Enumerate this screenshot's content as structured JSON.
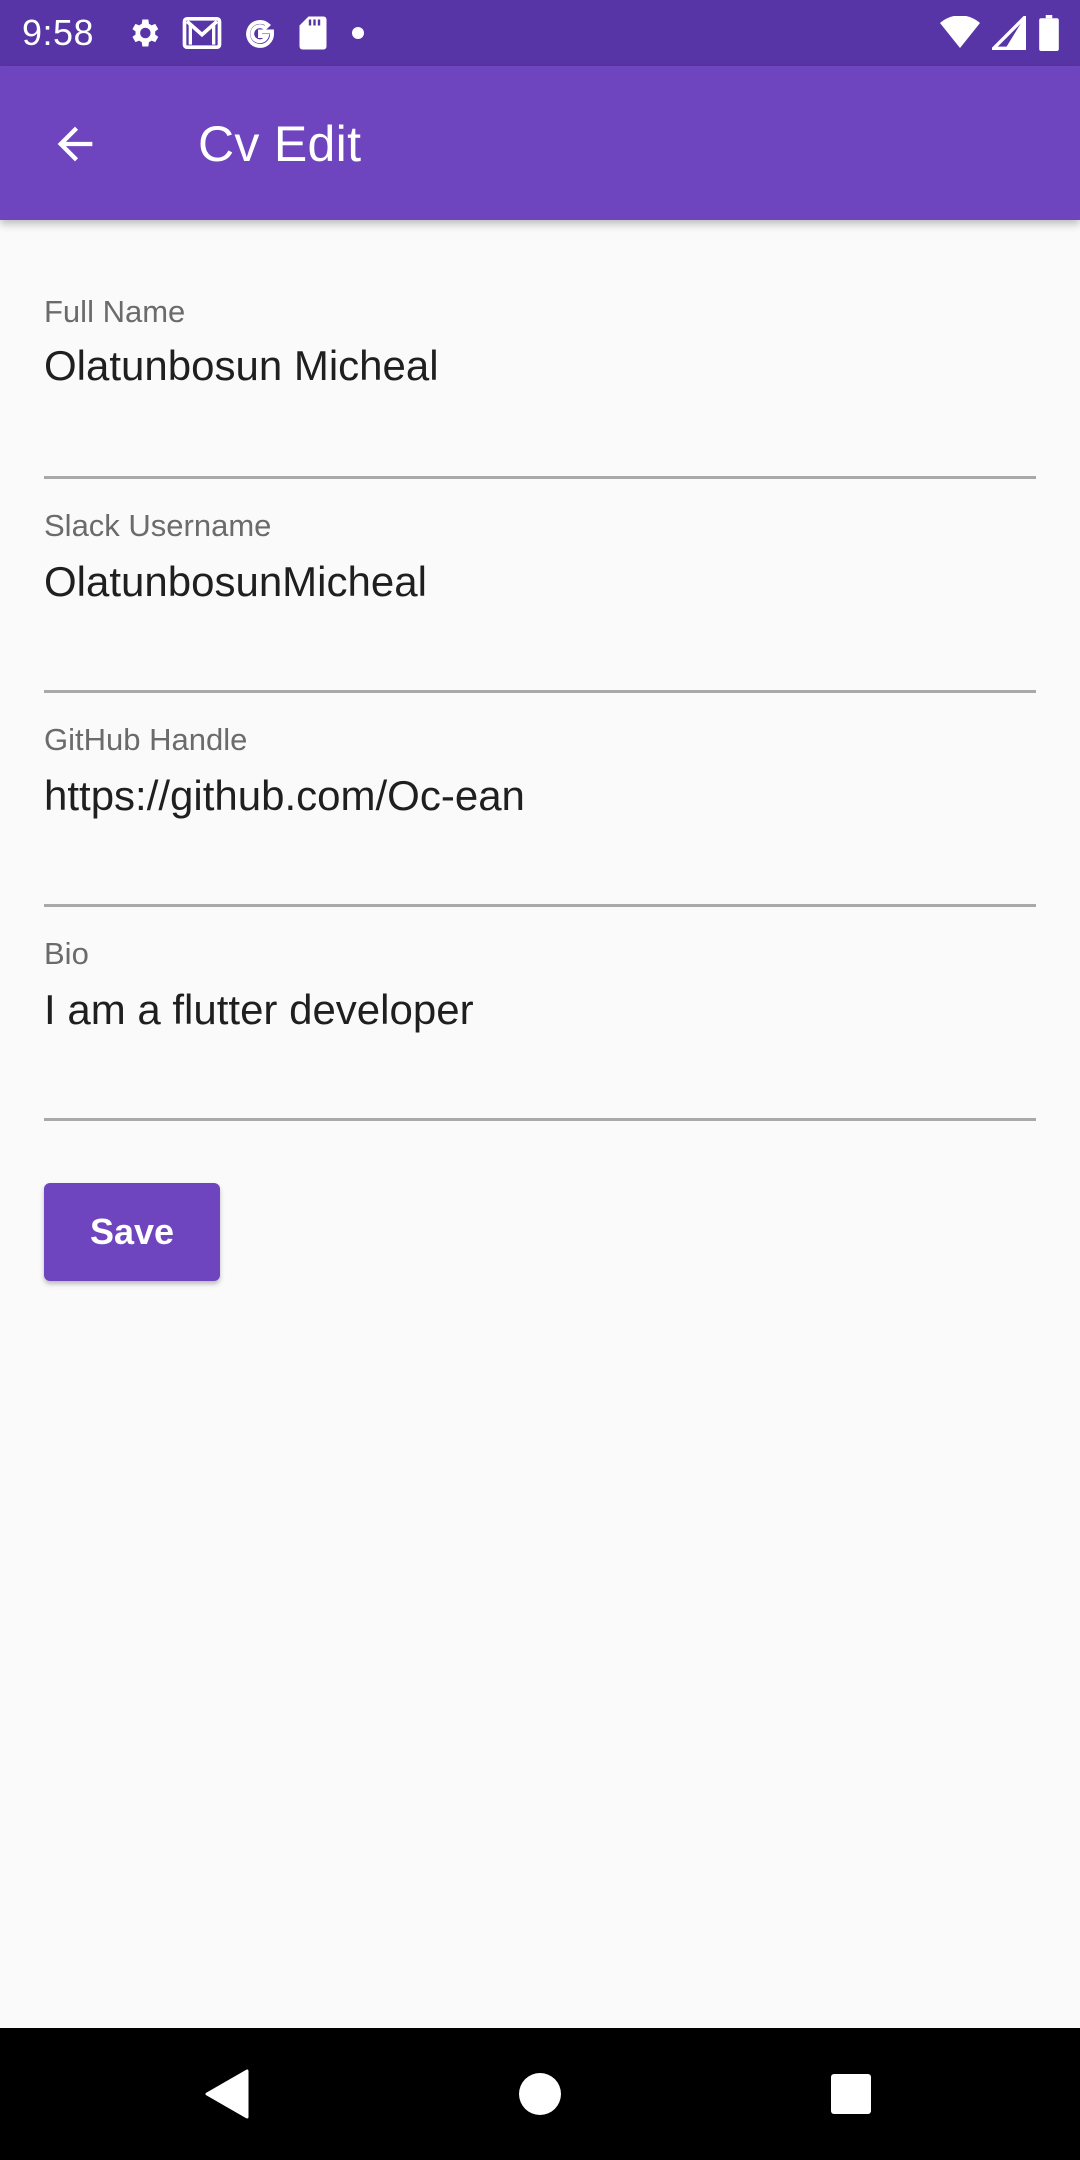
{
  "status_bar": {
    "time": "9:58",
    "left_icons": [
      "settings-icon",
      "gmail-icon",
      "google-icon",
      "sd-card-icon",
      "notification-dot-icon"
    ],
    "right_icons": [
      "wifi-icon",
      "signal-icon",
      "battery-icon"
    ]
  },
  "app_bar": {
    "back_icon": "arrow-back-icon",
    "title": "Cv Edit"
  },
  "form": {
    "fields": [
      {
        "label": "Full Name",
        "value": "Olatunbosun Micheal"
      },
      {
        "label": "Slack Username",
        "value": "OlatunbosunMicheal"
      },
      {
        "label": "GitHub Handle",
        "value": "https://github.com/Oc-ean"
      },
      {
        "label": "Bio",
        "value": "I am a flutter developer"
      }
    ],
    "save_label": "Save"
  },
  "nav_bar": {
    "buttons": [
      "back-triangle-icon",
      "home-circle-icon",
      "recents-square-icon"
    ]
  },
  "colors": {
    "status_bar": "#5835a6",
    "app_bar": "#6f45bf",
    "accent": "#6f45bf",
    "background": "#fafafa",
    "nav_bar": "#000000"
  }
}
